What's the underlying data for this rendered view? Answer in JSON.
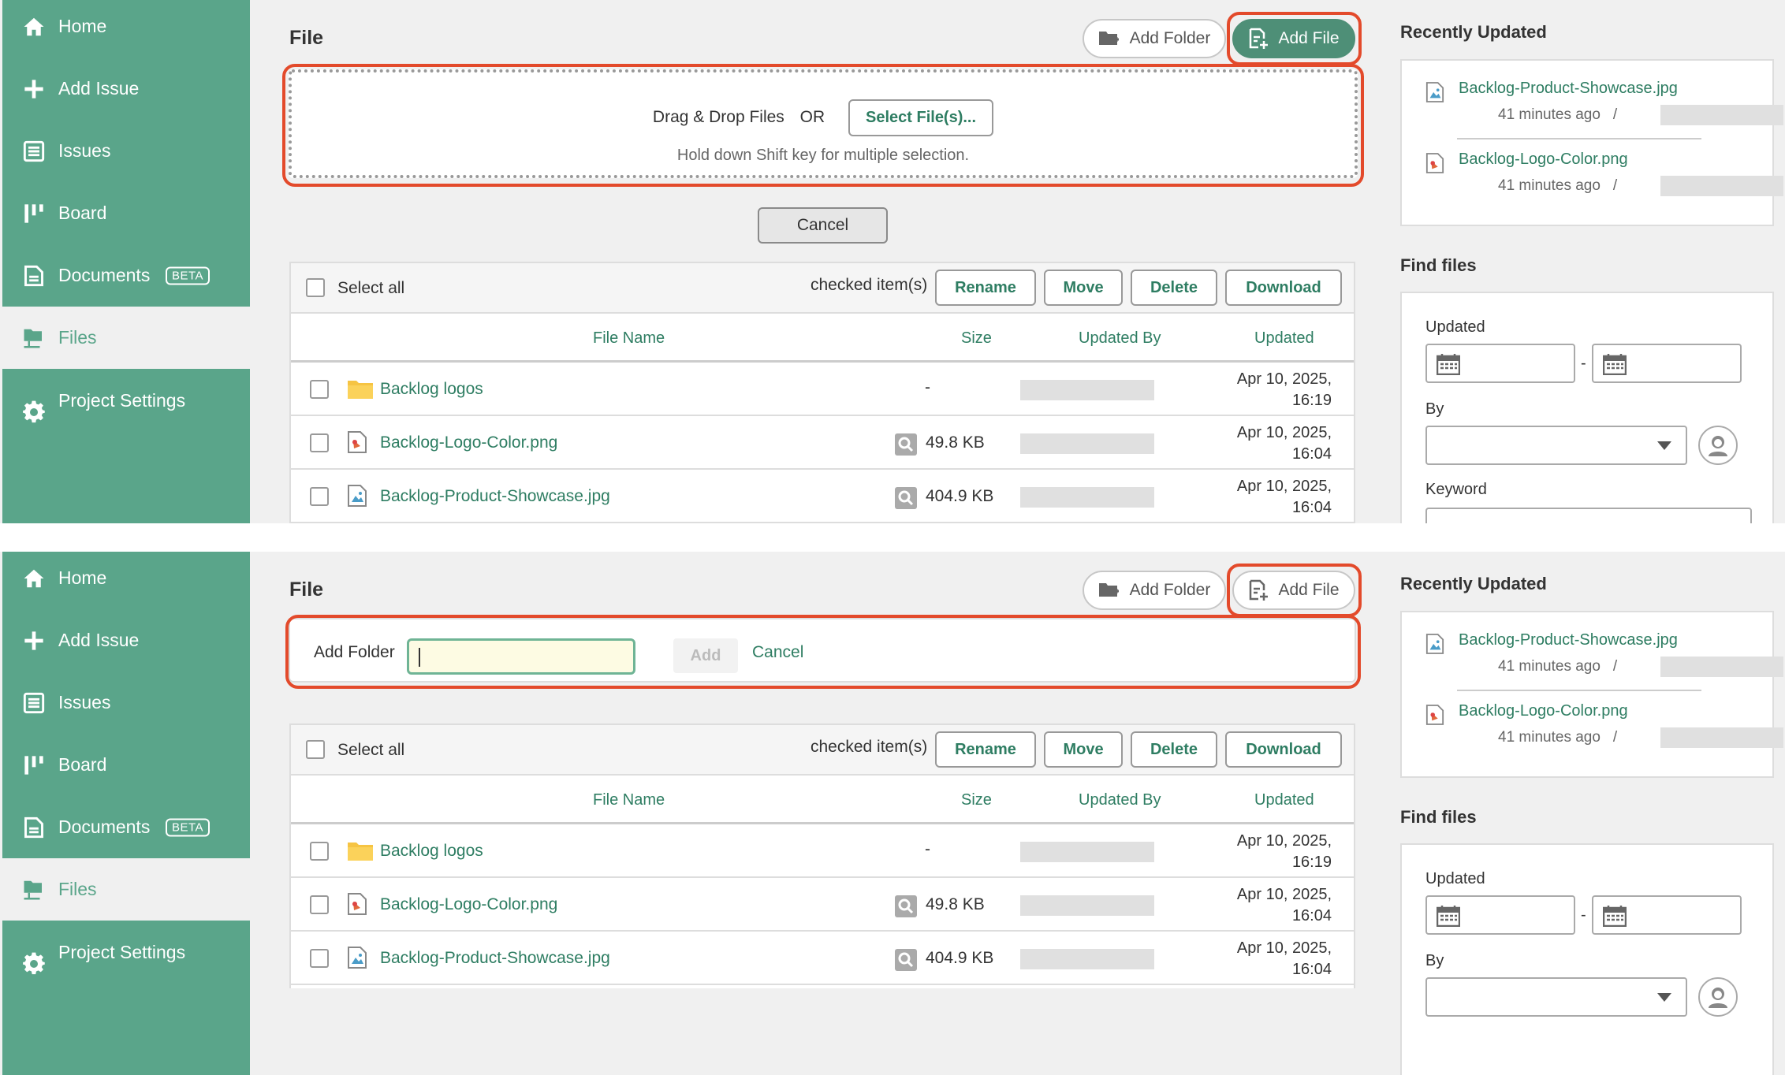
{
  "nav": {
    "items": [
      {
        "label": "Home",
        "icon": "home-icon"
      },
      {
        "label": "Add Issue",
        "icon": "plus-icon"
      },
      {
        "label": "Issues",
        "icon": "list-icon"
      },
      {
        "label": "Board",
        "icon": "board-icon"
      },
      {
        "label": "Documents",
        "icon": "document-icon",
        "badge": "BETA"
      },
      {
        "label": "Files",
        "icon": "files-icon",
        "active": true
      },
      {
        "label": "Project Settings",
        "icon": "gear-icon"
      }
    ]
  },
  "main": {
    "title": "File",
    "add_folder_label": "Add Folder",
    "add_file_label": "Add File",
    "drop": {
      "text": "Drag & Drop Files",
      "or": "OR",
      "select_label": "Select File(s)...",
      "hint": "Hold down Shift key for multiple selection."
    },
    "cancel_label": "Cancel",
    "toolbar": {
      "select_all": "Select all",
      "checked_items": "checked item(s)",
      "rename": "Rename",
      "move": "Move",
      "delete": "Delete",
      "download": "Download"
    },
    "columns": {
      "name": "File Name",
      "size": "Size",
      "updated_by": "Updated By",
      "updated": "Updated"
    },
    "files": [
      {
        "name": "Backlog logos",
        "type": "folder",
        "size": "-",
        "date1": "Apr 10, 2025,",
        "date2": "16:19"
      },
      {
        "name": "Backlog-Logo-Color.png",
        "type": "png",
        "size": "49.8 KB",
        "date1": "Apr 10, 2025,",
        "date2": "16:04"
      },
      {
        "name": "Backlog-Product-Showcase.jpg",
        "type": "jpg",
        "size": "404.9 KB",
        "date1": "Apr 10, 2025,",
        "date2": "16:04"
      }
    ],
    "add_folder_form": {
      "label": "Add Folder",
      "value": "",
      "add_label": "Add",
      "cancel_label": "Cancel"
    }
  },
  "right": {
    "recently_updated_title": "Recently Updated",
    "recent": [
      {
        "name": "Backlog-Product-Showcase.jpg",
        "ago": "41 minutes ago",
        "sep": "/"
      },
      {
        "name": "Backlog-Logo-Color.png",
        "ago": "41 minutes ago",
        "sep": "/"
      }
    ],
    "find_files_title": "Find files",
    "updated_label": "Updated",
    "range_sep": "-",
    "by_label": "By",
    "keyword_label": "Keyword"
  },
  "colors": {
    "accent": "#5aa58a",
    "highlight": "#e34a2b",
    "link": "#2e7d62"
  }
}
